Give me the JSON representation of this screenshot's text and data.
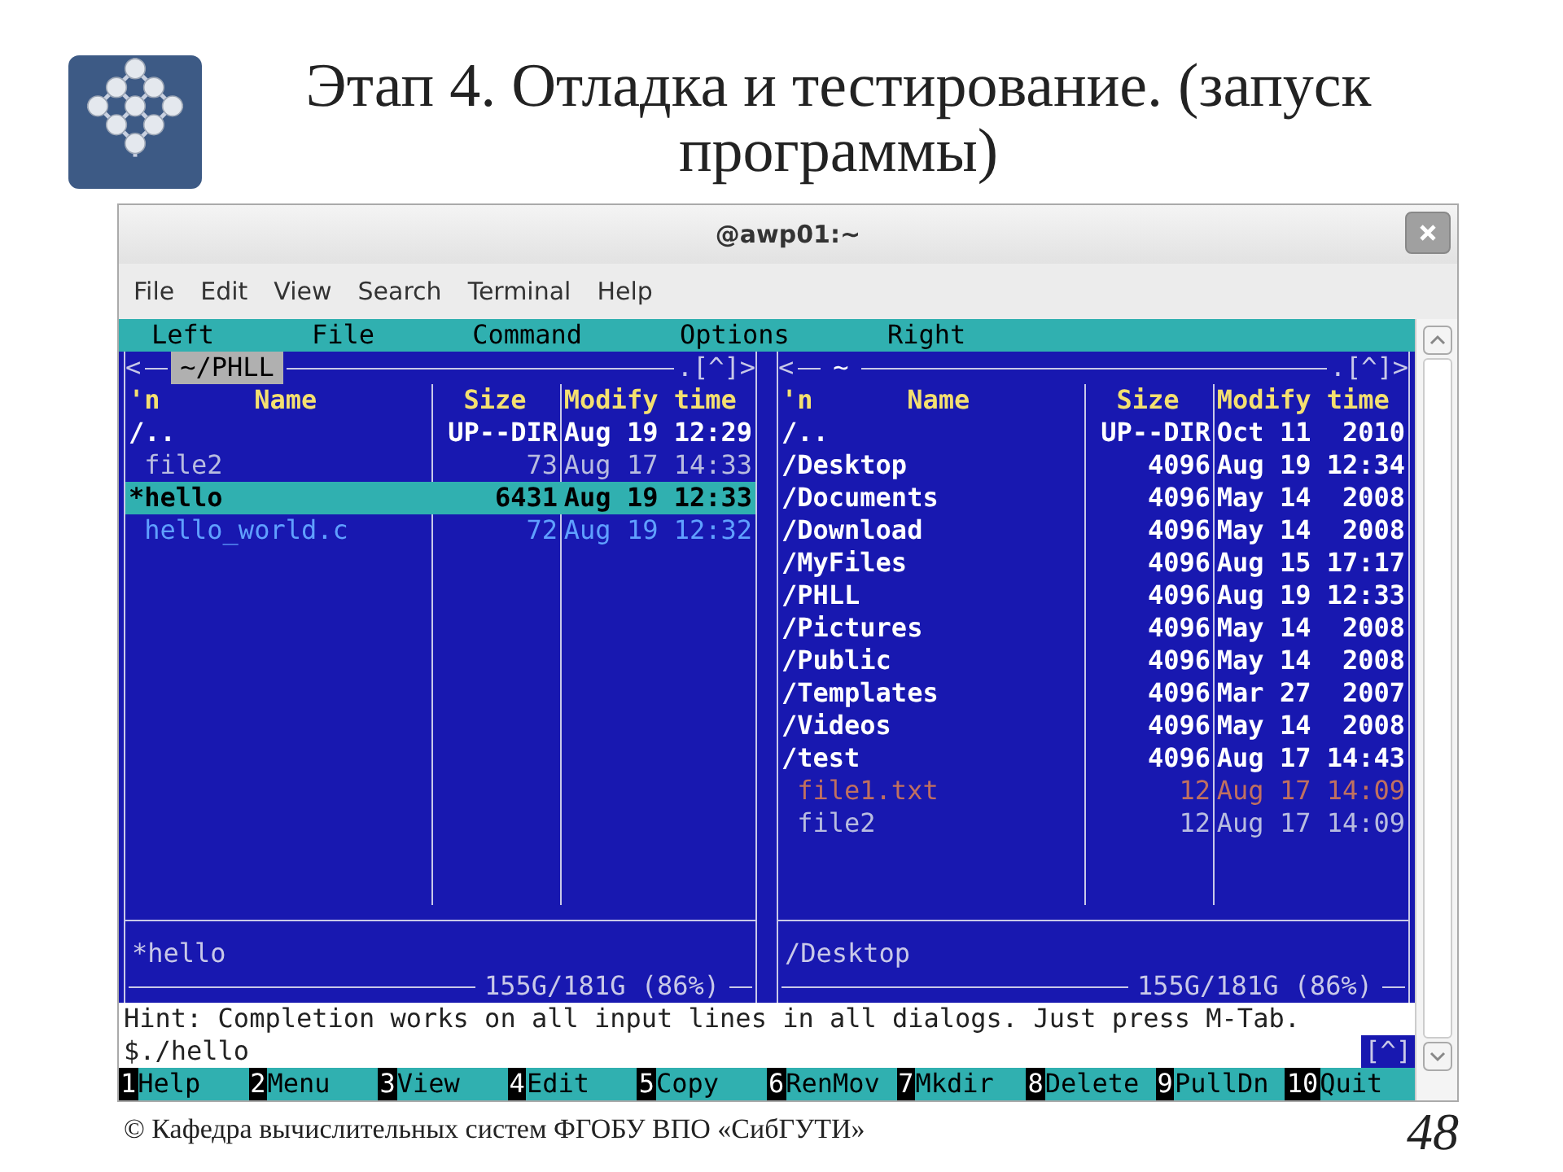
{
  "slide": {
    "title": "Этап 4. Отладка и тестирование. (запуск программы)",
    "footer": "© Кафедра вычислительных систем ФГОБУ ВПО «СибГУТИ»",
    "page": "48"
  },
  "window": {
    "title": "@awp01:~",
    "menu": [
      "File",
      "Edit",
      "View",
      "Search",
      "Terminal",
      "Help"
    ]
  },
  "mc": {
    "menu": [
      "Left",
      "File",
      "Command",
      "Options",
      "Right"
    ],
    "panels": [
      {
        "path": "~/PHLL",
        "active": true,
        "nav_left": "<",
        "nav_right": ".[^]>",
        "columns": [
          "'n",
          "Name",
          "Size",
          "Modify time"
        ],
        "status": "*hello",
        "disk": "155G/181G (86%)",
        "rows": [
          {
            "name": "/..",
            "size": "UP--DIR",
            "time": "Aug 19 12:29",
            "kind": "dir",
            "selected": false
          },
          {
            "name": " file2",
            "size": "73",
            "time": "Aug 17 14:33",
            "kind": "file",
            "selected": false
          },
          {
            "name": "*hello",
            "size": "6431",
            "time": "Aug 19 12:33",
            "kind": "exec",
            "selected": true
          },
          {
            "name": " hello_world.c",
            "size": "72",
            "time": "Aug 19 12:32",
            "kind": "source",
            "selected": false
          }
        ]
      },
      {
        "path": "~",
        "active": false,
        "nav_left": "<",
        "nav_right": ".[^]>",
        "columns": [
          "'n",
          "Name",
          "Size",
          "Modify time"
        ],
        "status": "/Desktop",
        "disk": "155G/181G (86%)",
        "rows": [
          {
            "name": "/..",
            "size": "UP--DIR",
            "time": "Oct 11  2010",
            "kind": "dir",
            "selected": false
          },
          {
            "name": "/Desktop",
            "size": "4096",
            "time": "Aug 19 12:34",
            "kind": "dir",
            "selected": false
          },
          {
            "name": "/Documents",
            "size": "4096",
            "time": "May 14  2008",
            "kind": "dir",
            "selected": false
          },
          {
            "name": "/Download",
            "size": "4096",
            "time": "May 14  2008",
            "kind": "dir",
            "selected": false
          },
          {
            "name": "/MyFiles",
            "size": "4096",
            "time": "Aug 15 17:17",
            "kind": "dir",
            "selected": false
          },
          {
            "name": "/PHLL",
            "size": "4096",
            "time": "Aug 19 12:33",
            "kind": "dir",
            "selected": false
          },
          {
            "name": "/Pictures",
            "size": "4096",
            "time": "May 14  2008",
            "kind": "dir",
            "selected": false
          },
          {
            "name": "/Public",
            "size": "4096",
            "time": "May 14  2008",
            "kind": "dir",
            "selected": false
          },
          {
            "name": "/Templates",
            "size": "4096",
            "time": "Mar 27  2007",
            "kind": "dir",
            "selected": false
          },
          {
            "name": "/Videos",
            "size": "4096",
            "time": "May 14  2008",
            "kind": "dir",
            "selected": false
          },
          {
            "name": "/test",
            "size": "4096",
            "time": "Aug 17 14:43",
            "kind": "dir",
            "selected": false
          },
          {
            "name": " file1.txt",
            "size": "12",
            "time": "Aug 17 14:09",
            "kind": "text",
            "selected": false
          },
          {
            "name": " file2",
            "size": "12",
            "time": "Aug 17 14:09",
            "kind": "file",
            "selected": false
          }
        ]
      }
    ],
    "hint": "Hint: Completion works on all input lines in all dialogs. Just press M-Tab.",
    "command": "$./hello",
    "history": "[^]",
    "fkeys": [
      {
        "num": "1",
        "label": "Help"
      },
      {
        "num": "2",
        "label": "Menu"
      },
      {
        "num": "3",
        "label": "View"
      },
      {
        "num": "4",
        "label": "Edit"
      },
      {
        "num": "5",
        "label": "Copy"
      },
      {
        "num": "6",
        "label": "RenMov"
      },
      {
        "num": "7",
        "label": "Mkdir"
      },
      {
        "num": "8",
        "label": "Delete"
      },
      {
        "num": "9",
        "label": "PullDn"
      },
      {
        "num": "10",
        "label": "Quit"
      }
    ]
  }
}
